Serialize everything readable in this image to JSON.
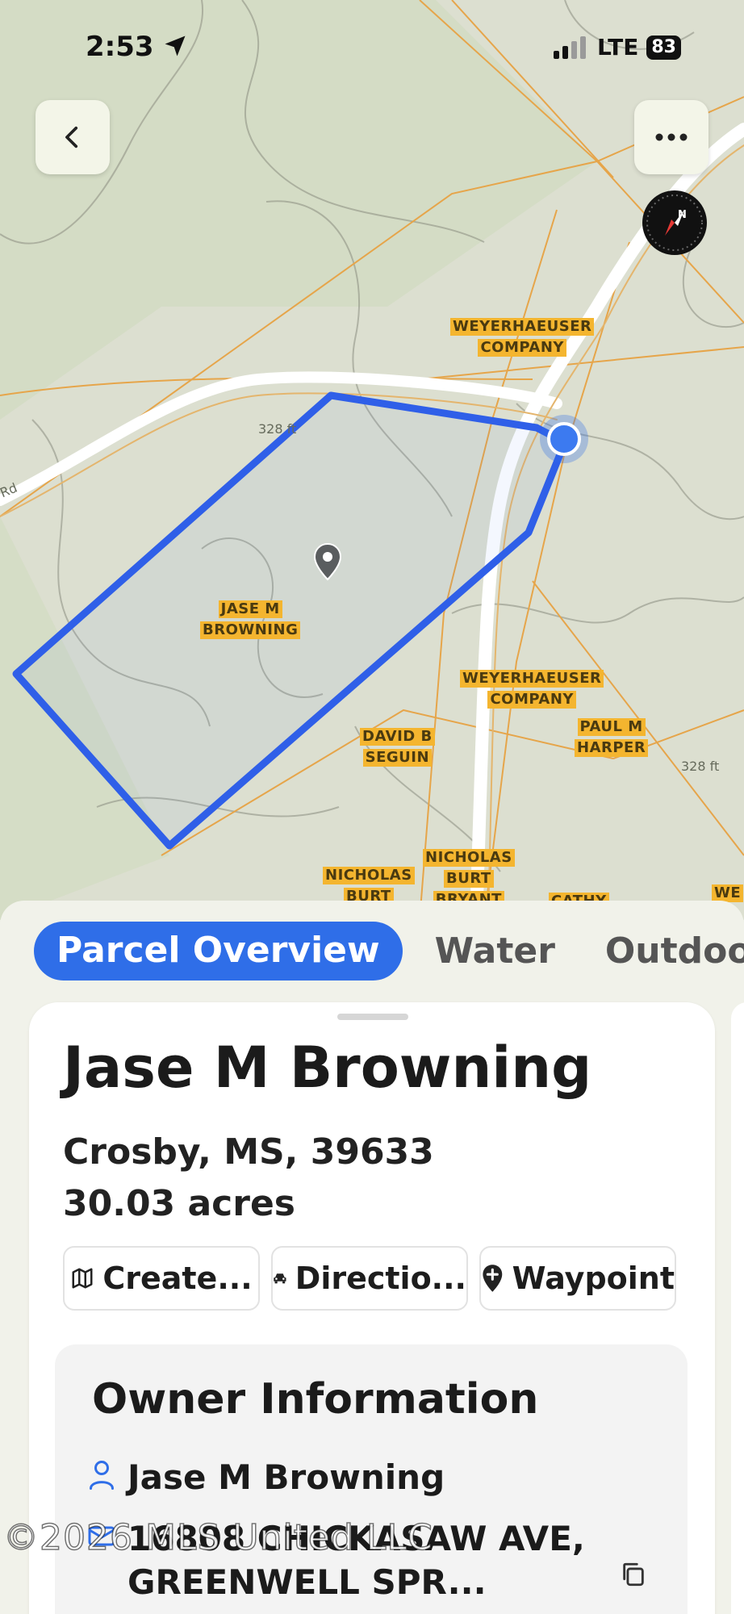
{
  "status_bar": {
    "time": "2:53",
    "network": "LTE",
    "battery": "83"
  },
  "map": {
    "owner_labels": [
      [
        "WEYERHAEUSER",
        "COMPANY"
      ],
      [
        "JASE M",
        "BROWNING"
      ],
      [
        "WEYERHAEUSER",
        "COMPANY"
      ],
      [
        "DAVID B",
        "SEGUIN"
      ],
      [
        "PAUL M",
        "HARPER"
      ],
      [
        "NICHOLAS",
        "BURT"
      ],
      [
        "NICHOLAS",
        "BURT",
        "BRYANT"
      ],
      [
        "CATHY"
      ],
      [
        "WE"
      ]
    ],
    "elevation_labels": [
      "328 ft",
      "328 ft"
    ],
    "road_label": "Rd",
    "colors": {
      "parcel_outline": "#2f5fe8",
      "property_lines": "#e6a54a",
      "roads": "#ffffff",
      "terrain_bg": "#dcdfd0"
    },
    "icons": {
      "back": "chevron-left-icon",
      "more": "more-horizontal-icon",
      "compass": "compass-icon",
      "location": "current-location-dot-icon",
      "pin": "map-pin-icon"
    }
  },
  "tabs": [
    {
      "label": "Parcel Overview",
      "active": true
    },
    {
      "label": "Water",
      "active": false
    },
    {
      "label": "Outdoors",
      "active": false
    }
  ],
  "parcel": {
    "name": "Jase M Browning",
    "location": "Crosby, MS, 39633",
    "acres": "30.03 acres"
  },
  "actions": [
    {
      "label": "Create...",
      "icon": "map-icon"
    },
    {
      "label": "Directio...",
      "icon": "car-icon"
    },
    {
      "label": "Waypoint",
      "icon": "waypoint-pin-icon"
    }
  ],
  "owner_info": {
    "title": "Owner Information",
    "owner_name": "Jase M Browning",
    "address": "16808 CHICKASAW AVE, GREENWELL SPR..."
  },
  "watermark": "©2026 MLS United LLC"
}
